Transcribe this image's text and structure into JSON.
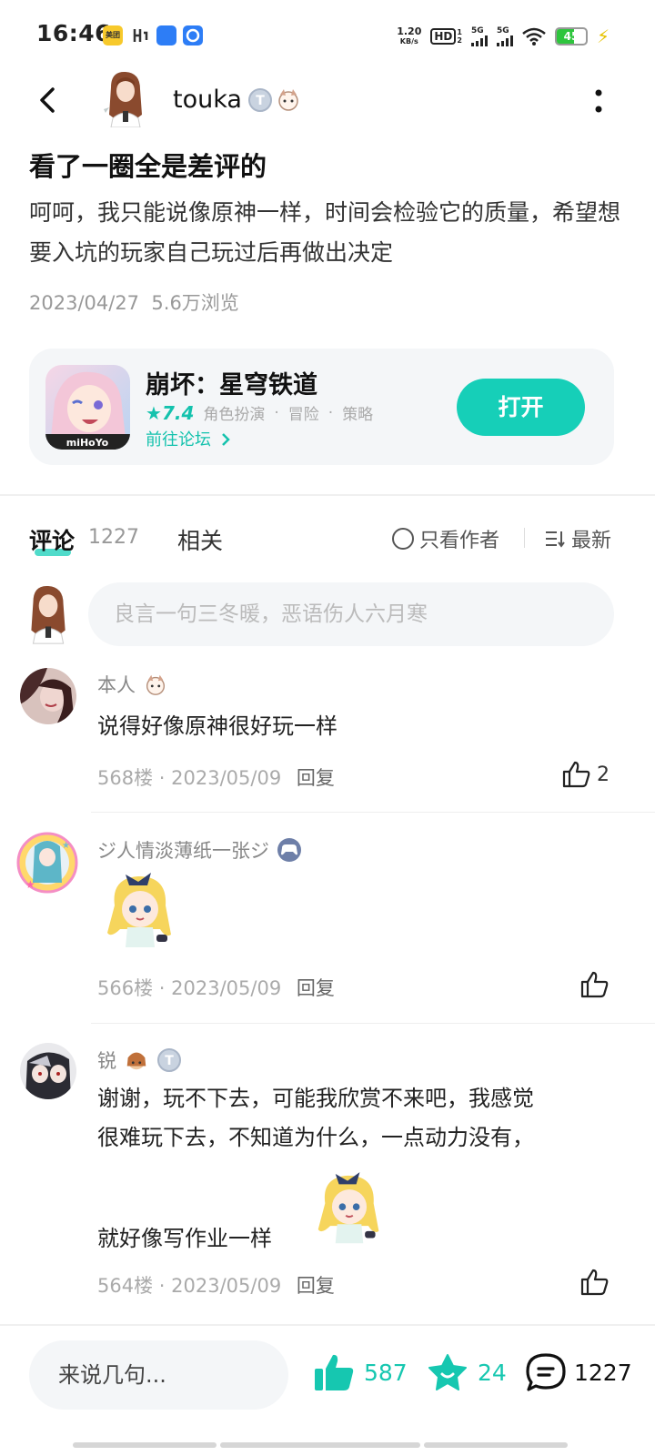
{
  "status_bar": {
    "time": "16:46",
    "app_icons": [
      "meituan-icon",
      "hoyolab-icon",
      "app-icon-blue",
      "browser-icon"
    ],
    "app_icon_labels": [
      "美团"
    ],
    "net_speed_value": "1.20",
    "net_speed_unit": "KB/s",
    "hd_label": "HD",
    "hd_sub": "1",
    "hd_sub2": "2",
    "net1": "5G",
    "net2": "5G",
    "battery": "45"
  },
  "header": {
    "author_name": "touka",
    "badge_t_label": "T"
  },
  "post": {
    "title": "看了一圈全是差评的",
    "body": "呵呵，我只能说像原神一样，时间会检验它的质量，希望想要入坑的玩家自己玩过后再做出决定",
    "date": "2023/04/27",
    "views": "5.6万浏览"
  },
  "game_card": {
    "name": "崩坏：星穹铁道",
    "rating": "7.4",
    "tags": [
      "角色扮演",
      "冒险",
      "策略"
    ],
    "tag_sep": "·",
    "forum_link": "前往论坛",
    "open_label": "打开",
    "icon_brand": "miHoYo"
  },
  "tabs": {
    "comments_label": "评论",
    "comments_count": "1227",
    "related_label": "相关",
    "only_author_label": "只看作者",
    "sort_label": "最新"
  },
  "comment_input": {
    "placeholder": "良言一句三冬暖，恶语伤人六月寒"
  },
  "comments": [
    {
      "name": "本人",
      "text": "说得好像原神很好玩一样",
      "floor": "568楼",
      "date": "2023/05/09",
      "reply": "回复",
      "likes": "2"
    },
    {
      "name": "ジ人情淡薄纸一张ジ",
      "text": "",
      "floor": "566楼",
      "date": "2023/05/09",
      "reply": "回复",
      "likes": ""
    },
    {
      "name": "锐",
      "badge_label": "T",
      "text_line1": "谢谢，玩不下去，可能我欣赏不来吧，我感觉",
      "text_line2": "很难玩下去，不知道为什么，一点动力没有，",
      "text_line3": "就好像写作业一样",
      "floor": "564楼",
      "date": "2023/05/09",
      "reply": "回复",
      "likes": ""
    }
  ],
  "meta_separator": "·",
  "bottom_bar": {
    "input_placeholder": "来说几句...",
    "likes": "587",
    "favorites": "24",
    "comments": "1227"
  },
  "colors": {
    "accent": "#16cfb8",
    "text_primary": "#111111",
    "text_secondary": "#999999"
  }
}
